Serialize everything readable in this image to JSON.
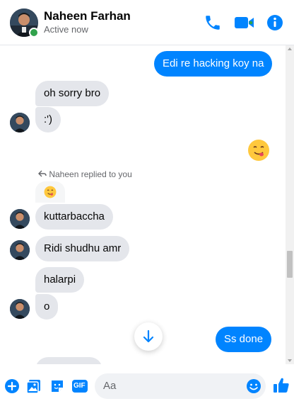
{
  "header": {
    "name": "Naheen Farhan",
    "status": "Active now",
    "accent": "#0084ff",
    "online_color": "#31a24c"
  },
  "messages": {
    "m1": "Edi re hacking koy na",
    "m2": "oh sorry bro",
    "m3": ":')",
    "m4_emoji": "face-savoring-food",
    "reply_note": "Naheen replied to you",
    "m5_reply_emoji": "face-savoring-food",
    "m6": "kuttarbaccha",
    "m7": "Ridi shudhu amr",
    "m8": "halarpi",
    "m9": "o",
    "m10": "Ss done"
  },
  "composer": {
    "placeholder": "Aa",
    "icons": [
      "plus-icon",
      "photo-icon",
      "sticker-icon",
      "gif-icon",
      "emoji-icon",
      "like-icon"
    ],
    "gif_label": "GIF"
  }
}
